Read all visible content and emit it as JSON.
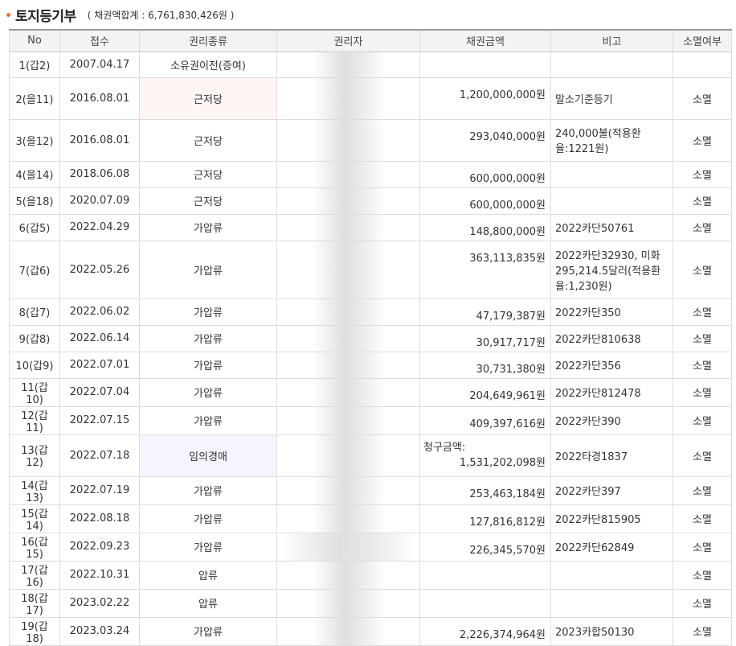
{
  "header": {
    "title": "토지등기부",
    "subtitle": "( 채권액합계 : 6,761,830,426원 )"
  },
  "columns": [
    "No",
    "접수",
    "권리종류",
    "권리자",
    "채권금액",
    "비고",
    "소멸여부"
  ],
  "rows": [
    {
      "no": "1(갑2)",
      "date": "2007.04.17",
      "type": "소유권이전(증여)",
      "amount": "",
      "note": "",
      "status": ""
    },
    {
      "no": "2(을11)",
      "date": "2016.08.01",
      "type": "근저당",
      "amount": "1,200,000,000원",
      "note": "말소기준등기",
      "status": "소멸"
    },
    {
      "no": "3(을12)",
      "date": "2016.08.01",
      "type": "근저당",
      "amount": "293,040,000원",
      "note": "240,000불(적용환율:1221원)",
      "status": "소멸"
    },
    {
      "no": "4(을14)",
      "date": "2018.06.08",
      "type": "근저당",
      "amount": "600,000,000원",
      "note": "",
      "status": "소멸"
    },
    {
      "no": "5(을18)",
      "date": "2020.07.09",
      "type": "근저당",
      "amount": "600,000,000원",
      "note": "",
      "status": "소멸"
    },
    {
      "no": "6(갑5)",
      "date": "2022.04.29",
      "type": "가압류",
      "amount": "148,800,000원",
      "note": "2022카단50761",
      "status": "소멸"
    },
    {
      "no": "7(갑6)",
      "date": "2022.05.26",
      "type": "가압류",
      "amount": "363,113,835원",
      "note": "2022카단32930, 미화295,214.5달러(적용환율:1,230원)",
      "status": "소멸"
    },
    {
      "no": "8(갑7)",
      "date": "2022.06.02",
      "type": "가압류",
      "amount": "47,179,387원",
      "note": "2022카단350",
      "status": "소멸"
    },
    {
      "no": "9(갑8)",
      "date": "2022.06.14",
      "type": "가압류",
      "amount": "30,917,717원",
      "note": "2022카단810638",
      "status": "소멸"
    },
    {
      "no": "10(갑9)",
      "date": "2022.07.01",
      "type": "가압류",
      "amount": "30,731,380원",
      "note": "2022카단356",
      "status": "소멸"
    },
    {
      "no": "11(갑10)",
      "date": "2022.07.04",
      "type": "가압류",
      "amount": "204,649,961원",
      "note": "2022카단812478",
      "status": "소멸"
    },
    {
      "no": "12(갑11)",
      "date": "2022.07.15",
      "type": "가압류",
      "amount": "409,397,616원",
      "note": "2022카단390",
      "status": "소멸"
    },
    {
      "no": "13(갑12)",
      "date": "2022.07.18",
      "type": "임의경매",
      "amount_label": "청구금액:",
      "amount": "1,531,202,098원",
      "note": "2022타경1837",
      "status": "소멸"
    },
    {
      "no": "14(갑13)",
      "date": "2022.07.19",
      "type": "가압류",
      "amount": "253,463,184원",
      "note": "2022카단397",
      "status": "소멸"
    },
    {
      "no": "15(갑14)",
      "date": "2022.08.18",
      "type": "가압류",
      "amount": "127,816,812원",
      "note": "2022카단815905",
      "status": "소멸"
    },
    {
      "no": "16(갑15)",
      "date": "2022.09.23",
      "type": "가압류",
      "amount": "226,345,570원",
      "note": "2022카단62849",
      "status": "소멸"
    },
    {
      "no": "17(갑16)",
      "date": "2022.10.31",
      "type": "압류",
      "amount": "",
      "note": "",
      "status": "소멸"
    },
    {
      "no": "18(갑17)",
      "date": "2023.02.22",
      "type": "압류",
      "amount": "",
      "note": "",
      "status": "소멸"
    },
    {
      "no": "19(갑18)",
      "date": "2023.03.24",
      "type": "가압류",
      "amount": "2,226,374,964원",
      "note": "2023카합50130",
      "status": "소멸"
    }
  ]
}
